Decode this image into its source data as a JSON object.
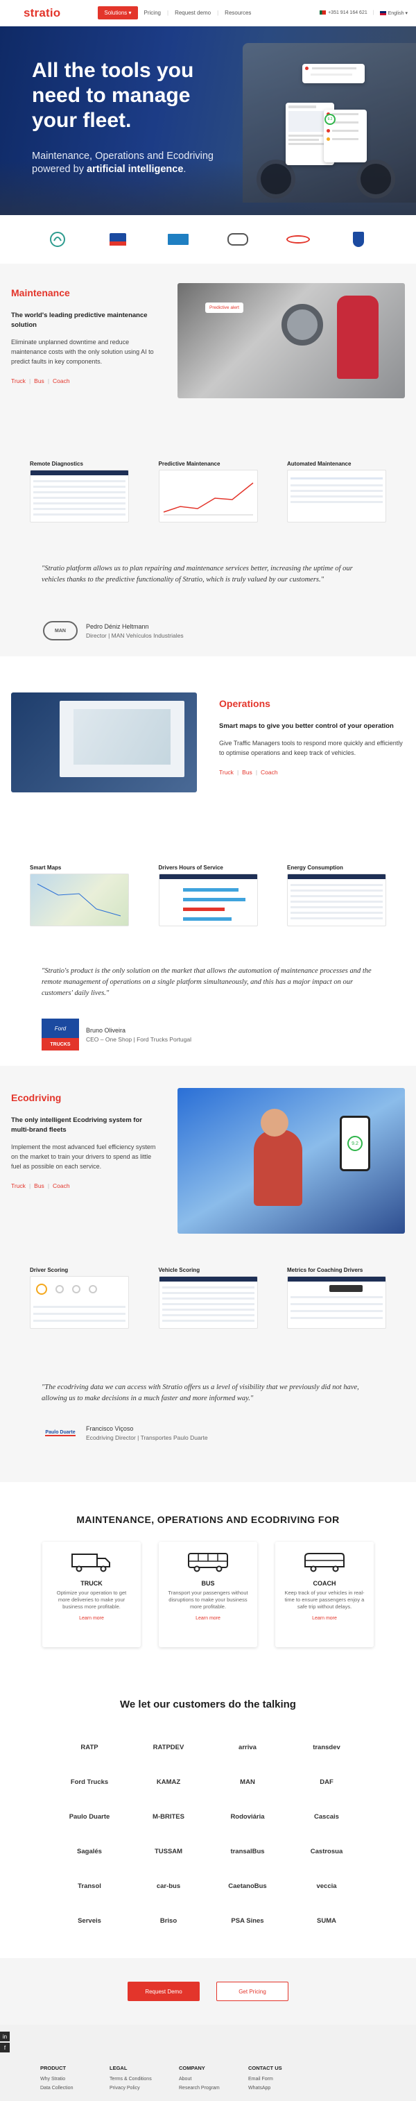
{
  "header": {
    "logo": "stratio",
    "solutions": "Solutions",
    "nav": [
      "Pricing",
      "Request demo",
      "Resources"
    ],
    "phone": "+351 914 164 621",
    "language": "English",
    "colors": {
      "accent": "#e3352b",
      "navy": "#1c3c86"
    }
  },
  "hero": {
    "title": "All the tools you need to manage your fleet.",
    "subtitle_pre": "Maintenance, Operations and Ecodriving powered by ",
    "subtitle_bold": "artificial intelligence",
    "subtitle_post": ".",
    "score": "9.2"
  },
  "partners": [
    "Stratio",
    "Ford",
    "Daimler",
    "MAN",
    "Transdev",
    "Kamaz"
  ],
  "maintenance": {
    "title": "Maintenance",
    "subtitle": "The world's leading predictive maintenance solution",
    "desc": "Eliminate unplanned downtime and reduce maintenance costs with the only solution using AI to predict faults in key components.",
    "links": [
      "Truck",
      "Bus",
      "Coach"
    ],
    "alert": "Predictive alert",
    "minis": [
      "Remote Diagnostics",
      "Predictive Maintenance",
      "Automated Maintenance"
    ],
    "quote": "\"Stratio platform allows us to plan repairing and maintenance services better, increasing the uptime of our vehicles thanks to the predictive functionality of Stratio, which is truly valued by our customers.\"",
    "person": "Pedro Déniz Heltmann",
    "role": "Director | MAN Vehículos Industriales",
    "logo_text": "MAN"
  },
  "operations": {
    "title": "Operations",
    "subtitle": "Smart maps to give you better control of your operation",
    "desc": "Give Traffic Managers tools to respond more quickly and efficiently to optimise operations and keep track of vehicles.",
    "links": [
      "Truck",
      "Bus",
      "Coach"
    ],
    "minis": [
      "Smart Maps",
      "Drivers Hours of Service",
      "Energy Consumption"
    ],
    "quote": "\"Stratio's product is the only solution on the market that allows the automation of maintenance processes and the remote management of operations on a single platform simultaneously, and this has a major impact on our customers' daily lives.\"",
    "person": "Bruno Oliveira",
    "role": "CEO – One Shop | Ford Trucks Portugal",
    "logo_text": "Ford",
    "logo_sub": "TRUCKS"
  },
  "ecodriving": {
    "title": "Ecodriving",
    "subtitle": "The only intelligent Ecodriving system for multi-brand fleets",
    "desc": "Implement the most advanced fuel efficiency system on the market to train your drivers to spend as little fuel as possible on each service.",
    "links": [
      "Truck",
      "Bus",
      "Coach"
    ],
    "phone_score": "9.2",
    "minis": [
      "Driver Scoring",
      "Vehicle Scoring",
      "Metrics for Coaching Drivers"
    ],
    "quote": "\"The ecodriving data we can access with Stratio offers us a level of visibility that we previously did not have, allowing us to make decisions in a much faster and more informed way.\"",
    "person": "Francisco Viçoso",
    "role": "Ecodriving Director | Transportes Paulo Duarte",
    "logo_text": "Paulo Duarte"
  },
  "segments": {
    "title": "MAINTENANCE, OPERATIONS AND ECODRIVING FOR",
    "cards": [
      {
        "name": "TRUCK",
        "desc": "Optimize your operation to get more deliveries to make your business more profitable.",
        "link": "Learn more"
      },
      {
        "name": "BUS",
        "desc": "Transport your passengers without disruptions to make your business more profitable.",
        "link": "Learn more"
      },
      {
        "name": "COACH",
        "desc": "Keep track of your vehicles in real-time to ensure passengers enjoy a safe trip without delays.",
        "link": "Learn more"
      }
    ]
  },
  "customers": {
    "title": "We let our customers do the talking",
    "logos": [
      "RATP",
      "RATPDEV",
      "arriva",
      "transdev",
      "Ford Trucks",
      "KAMAZ",
      "MAN",
      "DAF",
      "Paulo Duarte",
      "M-BRITES",
      "Rodoviária",
      "Cascais",
      "Sagalés",
      "TUSSAM",
      "transalBus",
      "Castrosua",
      "Transol",
      "car-bus",
      "CaetanoBus",
      "veccia",
      "Serveis",
      "Briso",
      "PSA Sines",
      "SUMA"
    ]
  },
  "cta": {
    "demo": "Request Demo",
    "pricing": "Get Pricing"
  },
  "footer": {
    "columns": [
      {
        "head": "PRODUCT",
        "items": [
          "Why Stratio",
          "Data Collection"
        ]
      },
      {
        "head": "LEGAL",
        "items": [
          "Terms & Conditions",
          "Privacy Policy"
        ]
      },
      {
        "head": "COMPANY",
        "items": [
          "About",
          "Research Program"
        ]
      },
      {
        "head": "CONTACT US",
        "items": [
          "Email Form",
          "WhatsApp"
        ]
      }
    ]
  }
}
